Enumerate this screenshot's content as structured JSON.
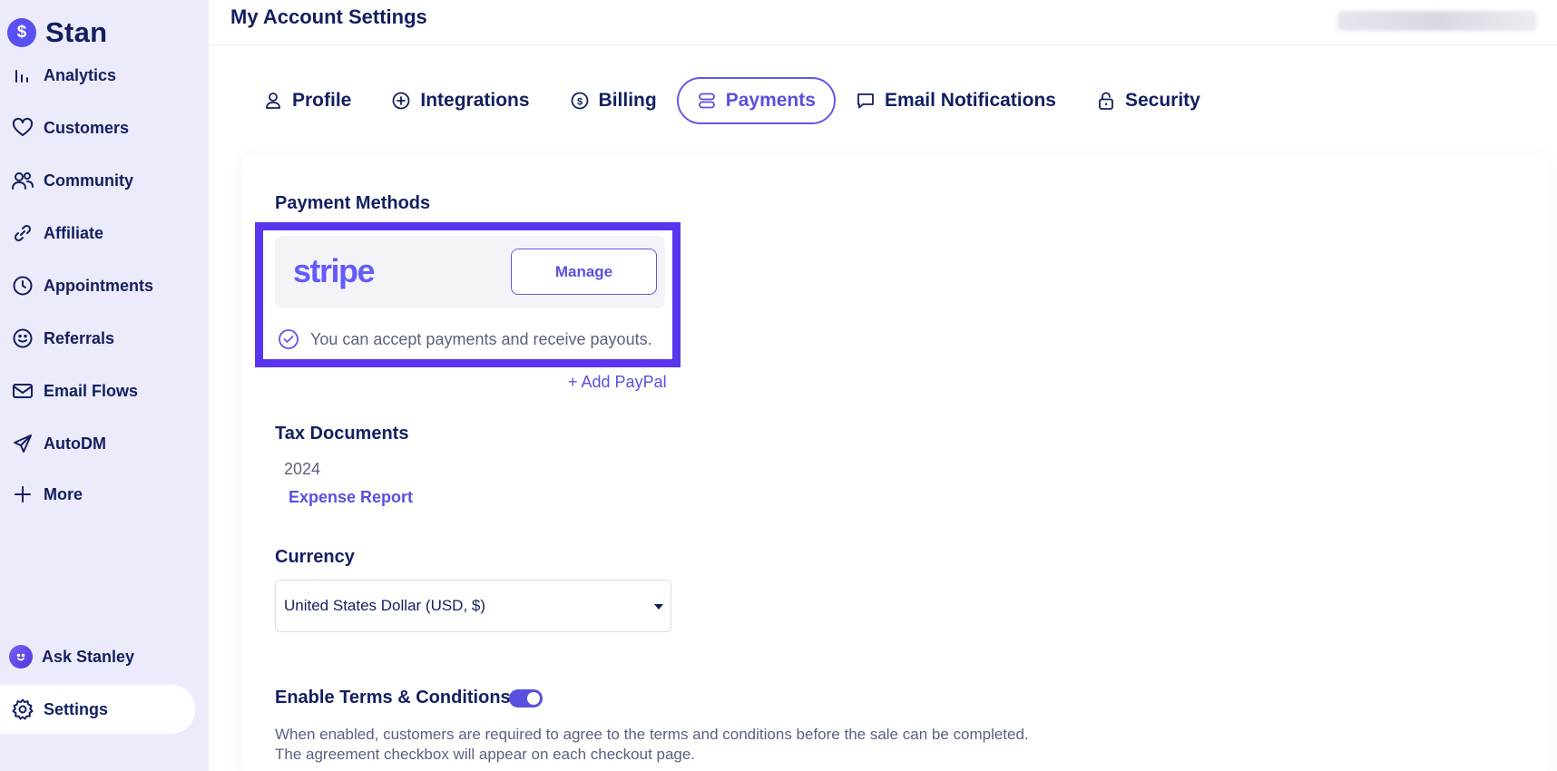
{
  "sidebar": {
    "brand": "Stan",
    "items": [
      {
        "label": "Analytics"
      },
      {
        "label": "Customers"
      },
      {
        "label": "Community"
      },
      {
        "label": "Affiliate"
      },
      {
        "label": "Appointments"
      },
      {
        "label": "Referrals"
      },
      {
        "label": "Email Flows"
      },
      {
        "label": "AutoDM"
      },
      {
        "label": "More"
      }
    ],
    "bottom": [
      {
        "label": "Ask Stanley"
      },
      {
        "label": "Settings"
      }
    ]
  },
  "header": {
    "title": "My Account Settings"
  },
  "tabs": [
    {
      "label": "Profile"
    },
    {
      "label": "Integrations"
    },
    {
      "label": "Billing"
    },
    {
      "label": "Payments"
    },
    {
      "label": "Email Notifications"
    },
    {
      "label": "Security"
    }
  ],
  "active_tab": "Payments",
  "payment_methods": {
    "title": "Payment Methods",
    "provider_logo": "stripe",
    "manage_label": "Manage",
    "status_text": "You can accept payments and receive payouts.",
    "add_paypal_label": "+ Add PayPal"
  },
  "tax_documents": {
    "title": "Tax Documents",
    "year": "2024",
    "report_link": "Expense Report"
  },
  "currency": {
    "title": "Currency",
    "selected": "United States Dollar (USD, $)"
  },
  "terms": {
    "title": "Enable Terms & Conditions",
    "enabled": true,
    "description_line1": "When enabled, customers are required to agree to the terms and conditions before the sale can be completed.",
    "description_line2": "The agreement checkbox will appear on each checkout page."
  },
  "colors": {
    "accent": "#5b4fe0",
    "highlight_border": "#5b35ee",
    "sidebar_bg": "#ecebfc",
    "text_dark": "#131f60",
    "stripe": "#635bff"
  }
}
